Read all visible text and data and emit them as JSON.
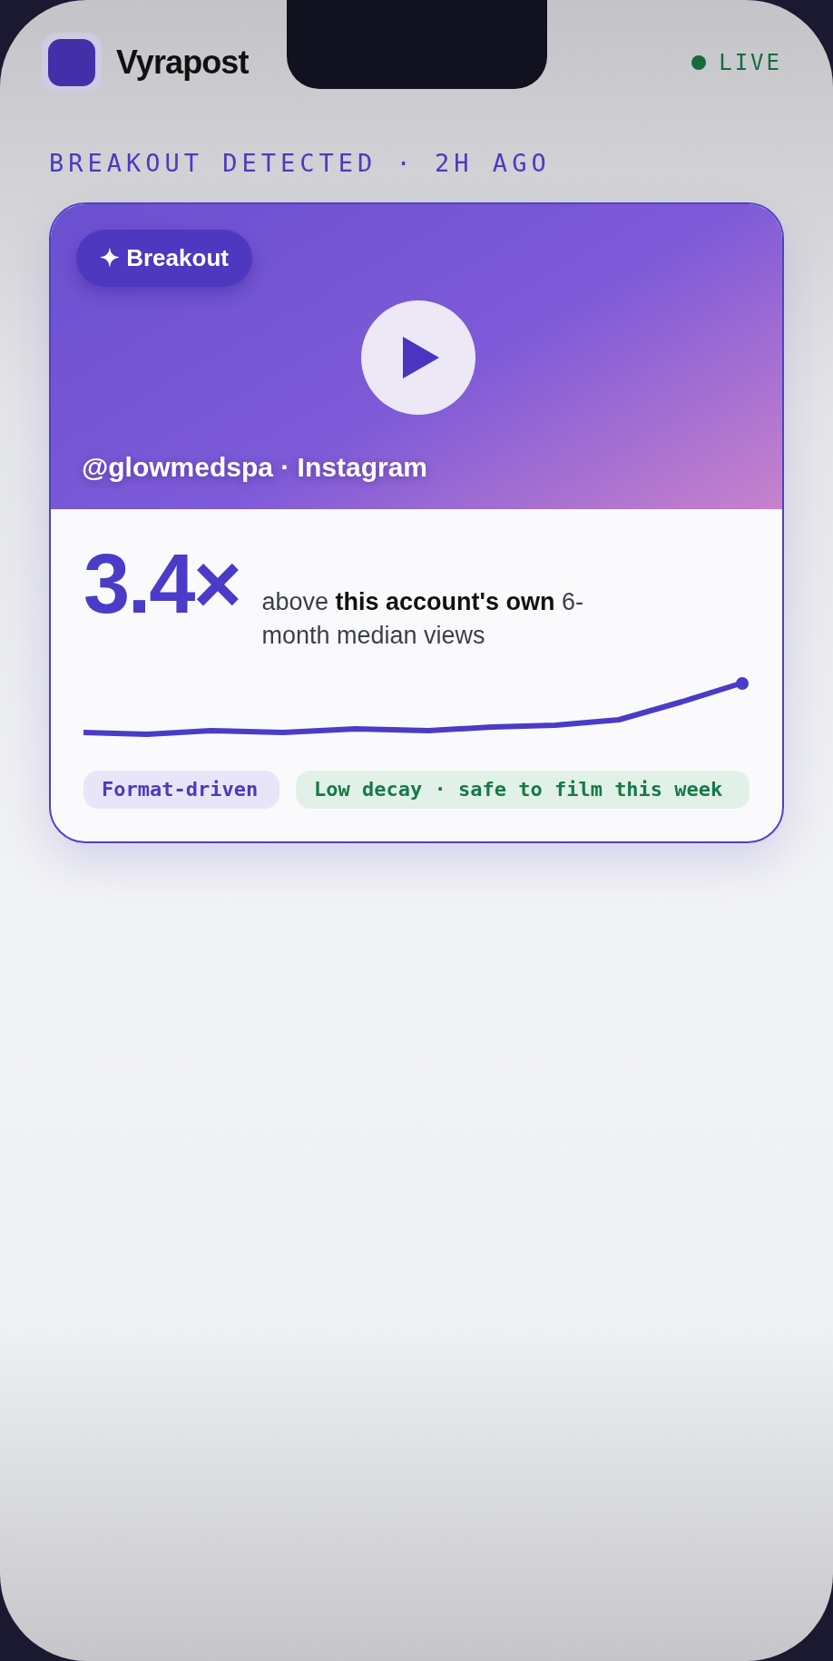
{
  "app": {
    "name": "Vyrapost",
    "status": "LIVE",
    "live": true
  },
  "eyebrow": "BREAKOUT DETECTED · 2H AGO",
  "card": {
    "badge": "✦ Breakout",
    "source": "@glowmedspa · Instagram",
    "multiplier": "3.4×",
    "description": "above **this account's own** 6-month median views",
    "tags": [
      {
        "label": "Format-driven",
        "kind": "format"
      },
      {
        "label": "Low decay · safe to film this week",
        "kind": "decay"
      }
    ]
  }
}
